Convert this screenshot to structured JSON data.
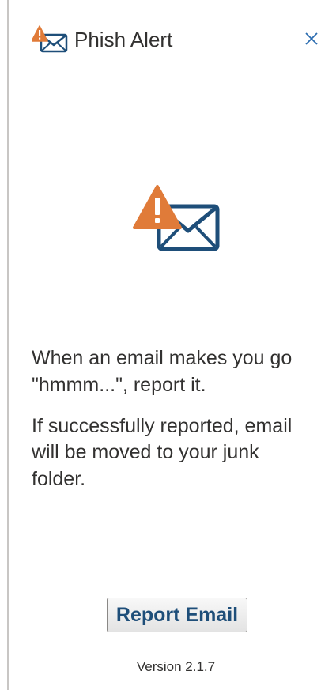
{
  "header": {
    "title": "Phish Alert",
    "logo_icon": "phish-alert-envelope-warning-icon",
    "close_icon": "close-icon"
  },
  "hero": {
    "icon": "phish-alert-envelope-warning-icon"
  },
  "message": {
    "line1": "When an email makes you go \"hmmm...\", report it.",
    "line2": "If successfully reported, email will be moved to your junk folder."
  },
  "actions": {
    "report_label": "Report Email"
  },
  "footer": {
    "version": "Version 2.1.7"
  },
  "colors": {
    "warning_orange": "#e07b39",
    "envelope_blue": "#1e4e79",
    "close_blue": "#2b6cb0"
  }
}
